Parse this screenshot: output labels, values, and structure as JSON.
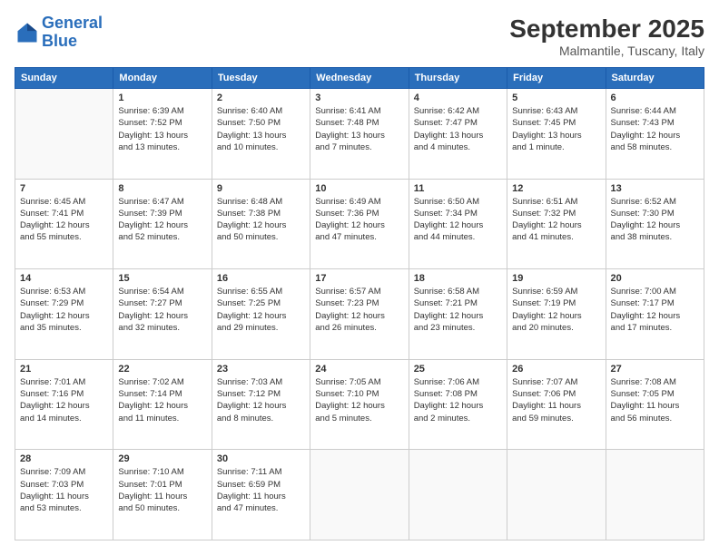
{
  "header": {
    "logo_line1": "General",
    "logo_line2": "Blue",
    "month": "September 2025",
    "location": "Malmantile, Tuscany, Italy"
  },
  "days_of_week": [
    "Sunday",
    "Monday",
    "Tuesday",
    "Wednesday",
    "Thursday",
    "Friday",
    "Saturday"
  ],
  "weeks": [
    [
      {
        "day": "",
        "info": ""
      },
      {
        "day": "1",
        "info": "Sunrise: 6:39 AM\nSunset: 7:52 PM\nDaylight: 13 hours\nand 13 minutes."
      },
      {
        "day": "2",
        "info": "Sunrise: 6:40 AM\nSunset: 7:50 PM\nDaylight: 13 hours\nand 10 minutes."
      },
      {
        "day": "3",
        "info": "Sunrise: 6:41 AM\nSunset: 7:48 PM\nDaylight: 13 hours\nand 7 minutes."
      },
      {
        "day": "4",
        "info": "Sunrise: 6:42 AM\nSunset: 7:47 PM\nDaylight: 13 hours\nand 4 minutes."
      },
      {
        "day": "5",
        "info": "Sunrise: 6:43 AM\nSunset: 7:45 PM\nDaylight: 13 hours\nand 1 minute."
      },
      {
        "day": "6",
        "info": "Sunrise: 6:44 AM\nSunset: 7:43 PM\nDaylight: 12 hours\nand 58 minutes."
      }
    ],
    [
      {
        "day": "7",
        "info": "Sunrise: 6:45 AM\nSunset: 7:41 PM\nDaylight: 12 hours\nand 55 minutes."
      },
      {
        "day": "8",
        "info": "Sunrise: 6:47 AM\nSunset: 7:39 PM\nDaylight: 12 hours\nand 52 minutes."
      },
      {
        "day": "9",
        "info": "Sunrise: 6:48 AM\nSunset: 7:38 PM\nDaylight: 12 hours\nand 50 minutes."
      },
      {
        "day": "10",
        "info": "Sunrise: 6:49 AM\nSunset: 7:36 PM\nDaylight: 12 hours\nand 47 minutes."
      },
      {
        "day": "11",
        "info": "Sunrise: 6:50 AM\nSunset: 7:34 PM\nDaylight: 12 hours\nand 44 minutes."
      },
      {
        "day": "12",
        "info": "Sunrise: 6:51 AM\nSunset: 7:32 PM\nDaylight: 12 hours\nand 41 minutes."
      },
      {
        "day": "13",
        "info": "Sunrise: 6:52 AM\nSunset: 7:30 PM\nDaylight: 12 hours\nand 38 minutes."
      }
    ],
    [
      {
        "day": "14",
        "info": "Sunrise: 6:53 AM\nSunset: 7:29 PM\nDaylight: 12 hours\nand 35 minutes."
      },
      {
        "day": "15",
        "info": "Sunrise: 6:54 AM\nSunset: 7:27 PM\nDaylight: 12 hours\nand 32 minutes."
      },
      {
        "day": "16",
        "info": "Sunrise: 6:55 AM\nSunset: 7:25 PM\nDaylight: 12 hours\nand 29 minutes."
      },
      {
        "day": "17",
        "info": "Sunrise: 6:57 AM\nSunset: 7:23 PM\nDaylight: 12 hours\nand 26 minutes."
      },
      {
        "day": "18",
        "info": "Sunrise: 6:58 AM\nSunset: 7:21 PM\nDaylight: 12 hours\nand 23 minutes."
      },
      {
        "day": "19",
        "info": "Sunrise: 6:59 AM\nSunset: 7:19 PM\nDaylight: 12 hours\nand 20 minutes."
      },
      {
        "day": "20",
        "info": "Sunrise: 7:00 AM\nSunset: 7:17 PM\nDaylight: 12 hours\nand 17 minutes."
      }
    ],
    [
      {
        "day": "21",
        "info": "Sunrise: 7:01 AM\nSunset: 7:16 PM\nDaylight: 12 hours\nand 14 minutes."
      },
      {
        "day": "22",
        "info": "Sunrise: 7:02 AM\nSunset: 7:14 PM\nDaylight: 12 hours\nand 11 minutes."
      },
      {
        "day": "23",
        "info": "Sunrise: 7:03 AM\nSunset: 7:12 PM\nDaylight: 12 hours\nand 8 minutes."
      },
      {
        "day": "24",
        "info": "Sunrise: 7:05 AM\nSunset: 7:10 PM\nDaylight: 12 hours\nand 5 minutes."
      },
      {
        "day": "25",
        "info": "Sunrise: 7:06 AM\nSunset: 7:08 PM\nDaylight: 12 hours\nand 2 minutes."
      },
      {
        "day": "26",
        "info": "Sunrise: 7:07 AM\nSunset: 7:06 PM\nDaylight: 11 hours\nand 59 minutes."
      },
      {
        "day": "27",
        "info": "Sunrise: 7:08 AM\nSunset: 7:05 PM\nDaylight: 11 hours\nand 56 minutes."
      }
    ],
    [
      {
        "day": "28",
        "info": "Sunrise: 7:09 AM\nSunset: 7:03 PM\nDaylight: 11 hours\nand 53 minutes."
      },
      {
        "day": "29",
        "info": "Sunrise: 7:10 AM\nSunset: 7:01 PM\nDaylight: 11 hours\nand 50 minutes."
      },
      {
        "day": "30",
        "info": "Sunrise: 7:11 AM\nSunset: 6:59 PM\nDaylight: 11 hours\nand 47 minutes."
      },
      {
        "day": "",
        "info": ""
      },
      {
        "day": "",
        "info": ""
      },
      {
        "day": "",
        "info": ""
      },
      {
        "day": "",
        "info": ""
      }
    ]
  ]
}
